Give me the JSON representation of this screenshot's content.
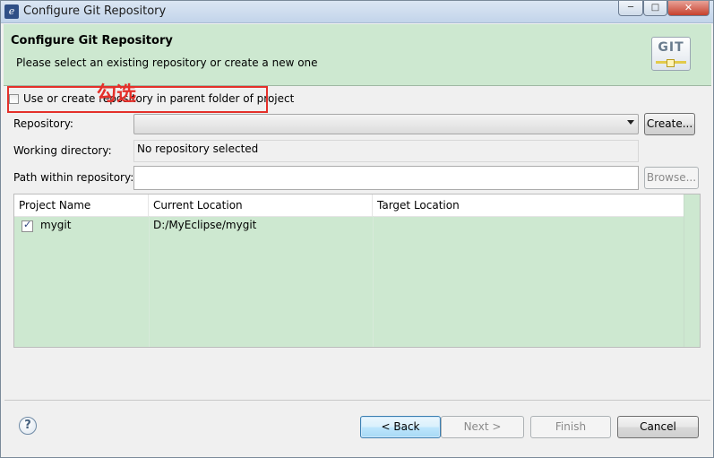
{
  "window": {
    "title": "Configure Git Repository",
    "controls": {
      "minimize": "─",
      "maximize": "□",
      "close": "✕"
    }
  },
  "banner": {
    "title": "Configure Git Repository",
    "description": "Please select an existing repository or create a new one",
    "logo_text": "GIT"
  },
  "form": {
    "use_parent_label": "Use or create repository in parent folder of project",
    "use_parent_checked": false,
    "repository_label": "Repository:",
    "repository_value": "",
    "create_button": "Create...",
    "working_dir_label": "Working directory:",
    "working_dir_value": "No repository selected",
    "path_label": "Path within repository:",
    "path_value": "",
    "browse_button": "Browse..."
  },
  "table": {
    "columns": [
      "Project Name",
      "Current Location",
      "Target Location"
    ],
    "rows": [
      {
        "checked": true,
        "project": "mygit",
        "current": "D:/MyEclipse/mygit",
        "target": ""
      }
    ]
  },
  "buttons": {
    "help": "?",
    "back": "< Back",
    "next": "Next >",
    "finish": "Finish",
    "cancel": "Cancel"
  },
  "annotation": {
    "text": "勾选",
    "color": "#e4302a"
  },
  "colors": {
    "banner_bg": "#cde8d0",
    "table_bg": "#cde8d0"
  }
}
